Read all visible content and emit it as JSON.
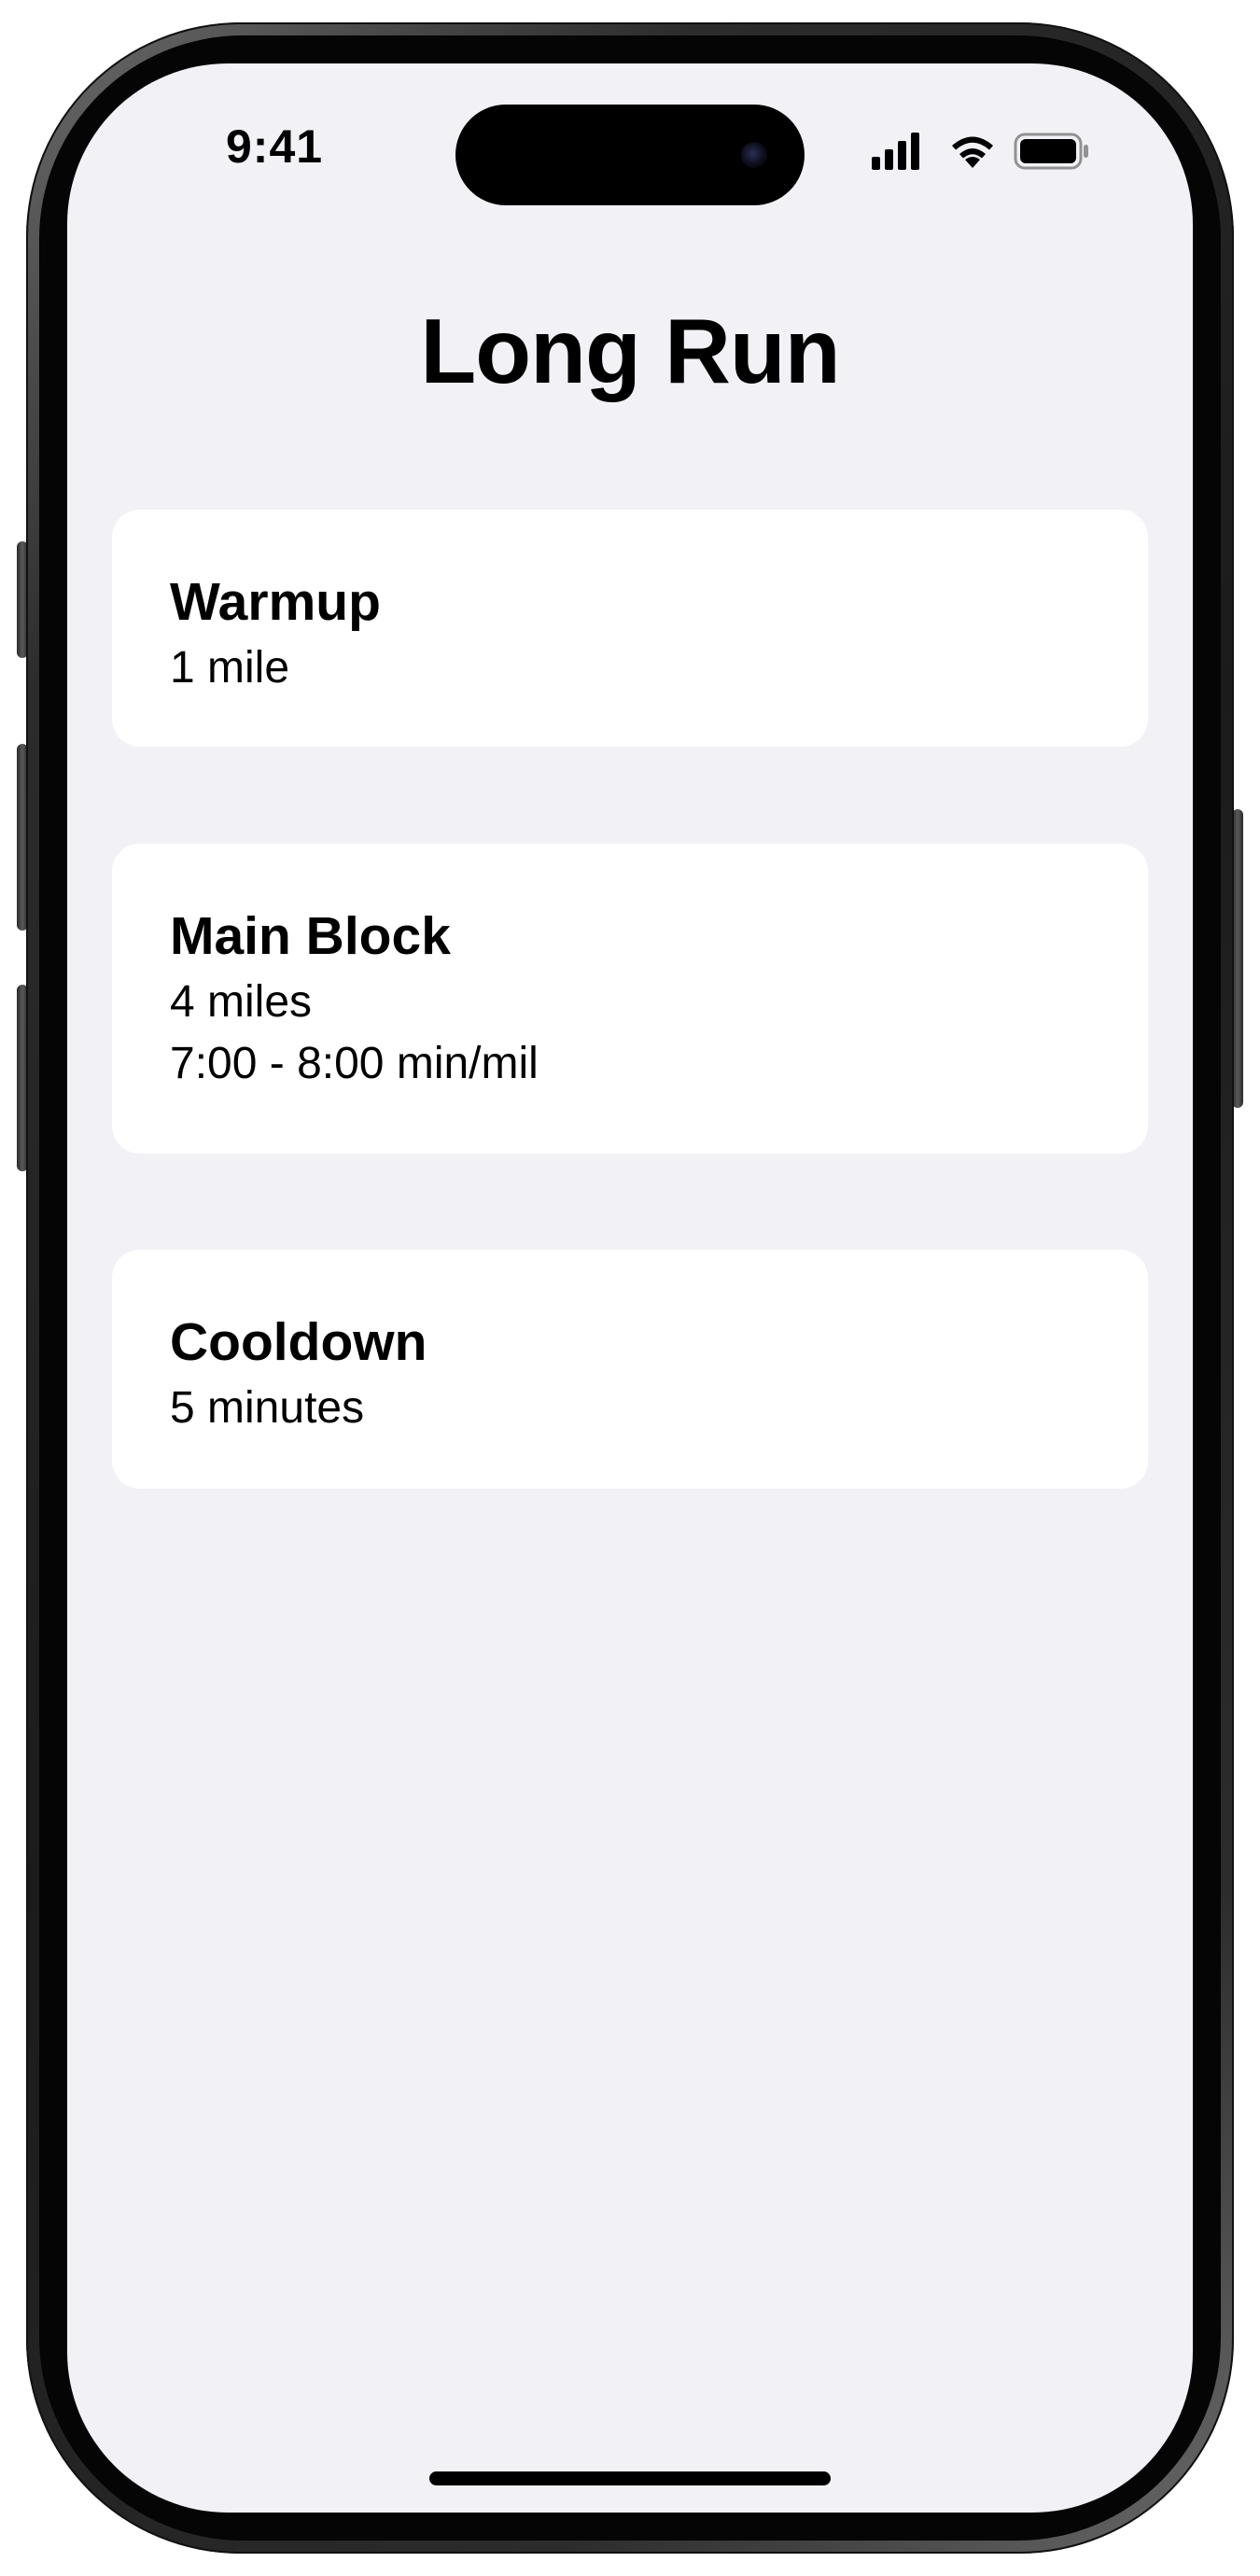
{
  "status_bar": {
    "time": "9:41",
    "signal_icon": "cellular-signal-icon",
    "wifi_icon": "wifi-icon",
    "battery_icon": "battery-icon"
  },
  "header": {
    "title": "Long Run"
  },
  "workout_steps": [
    {
      "title": "Warmup",
      "lines": [
        "1 mile"
      ]
    },
    {
      "title": "Main Block",
      "lines": [
        "4 miles",
        "7:00 - 8:00 min/mil"
      ]
    },
    {
      "title": "Cooldown",
      "lines": [
        "5 minutes"
      ]
    }
  ],
  "colors": {
    "background": "#f2f2f6",
    "card": "#ffffff",
    "text": "#000000"
  }
}
